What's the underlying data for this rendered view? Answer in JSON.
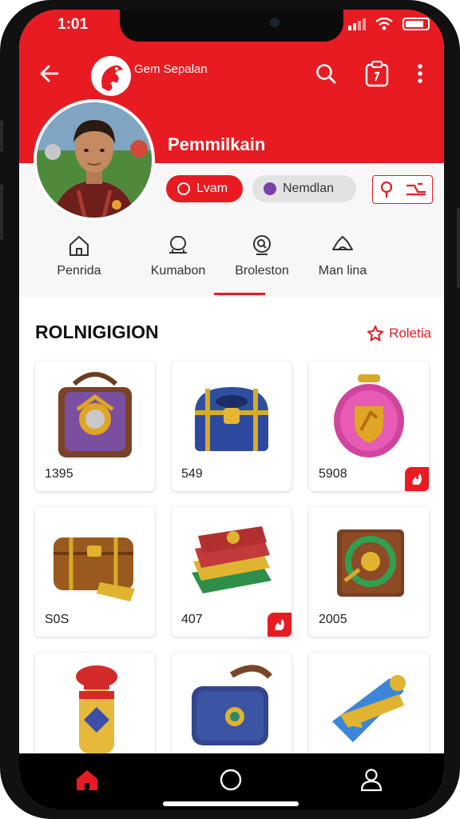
{
  "status_bar": {
    "time": "1:01"
  },
  "header": {
    "brand_name": "Gem Sepalan",
    "profile_name": "Pemmilkain",
    "back_icon": "arrow-left-icon",
    "search_icon": "search-icon",
    "clipboard_icon": "clipboard-icon",
    "more_icon": "more-vertical-icon"
  },
  "pills": [
    {
      "label": "Lvam",
      "icon": "target-icon"
    },
    {
      "label": "Nemdlan",
      "icon": "purple-badge-icon"
    }
  ],
  "filter": {
    "icon1": "pin-icon",
    "icon2": "filter-lines-icon"
  },
  "tabs": [
    {
      "label": "Penrida",
      "icon": "home-outline-icon"
    },
    {
      "label": "Kumabon",
      "icon": "lamp-icon"
    },
    {
      "label": "Broleston",
      "icon": "search-circle-icon"
    },
    {
      "label": "Man lina",
      "icon": "hat-icon"
    }
  ],
  "section": {
    "title": "ROLNIGIGION",
    "link": "Roletia",
    "link_icon": "star-outline-icon"
  },
  "items": [
    {
      "price": "1395",
      "art": "purple-bag",
      "badge": false
    },
    {
      "price": "549",
      "art": "blue-chest",
      "badge": false
    },
    {
      "price": "5908",
      "art": "pink-shield-orb",
      "badge": true
    },
    {
      "price": "S0S",
      "art": "brown-trunk",
      "badge": false
    },
    {
      "price": "407",
      "art": "book-stack",
      "badge": true
    },
    {
      "price": "2005",
      "art": "green-tome",
      "badge": false
    },
    {
      "price": "",
      "art": "red-pillar",
      "badge": false
    },
    {
      "price": "",
      "art": "blue-satchel",
      "badge": false
    },
    {
      "price": "",
      "art": "blue-horn",
      "badge": false
    }
  ],
  "colors": {
    "accent": "#e81b22",
    "nav_bg": "#000000"
  },
  "bottom_nav": [
    {
      "icon": "home-icon"
    },
    {
      "icon": "circle-icon"
    },
    {
      "icon": "user-icon"
    }
  ]
}
